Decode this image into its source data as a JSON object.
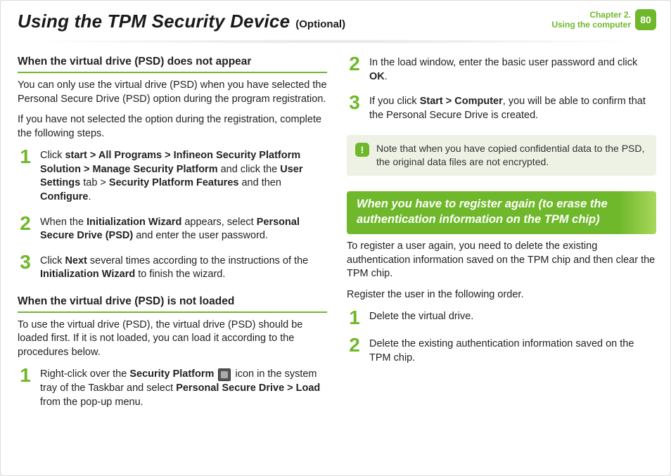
{
  "header": {
    "title": "Using the TPM Security Device",
    "subtitle": "(Optional)",
    "chapter_line1": "Chapter 2.",
    "chapter_line2": "Using the computer",
    "page_number": "80"
  },
  "left": {
    "sec1": {
      "heading": "When the virtual drive (PSD) does not appear",
      "p1": "You can only use the virtual drive (PSD) when you have selected the Personal Secure Drive (PSD) option during the program registration.",
      "p2": " If you have not selected the option during the registration, complete the following steps.",
      "steps": [
        {
          "n": "1",
          "parts": [
            {
              "t": "Click "
            },
            {
              "t": "start > All Programs > Infineon Security Platform Solution > Manage Security Platform",
              "b": true
            },
            {
              "t": " and click the "
            },
            {
              "t": "User Settings",
              "b": true
            },
            {
              "t": " tab > "
            },
            {
              "t": "Security Platform Features",
              "b": true
            },
            {
              "t": " and then "
            },
            {
              "t": "Configure",
              "b": true
            },
            {
              "t": "."
            }
          ]
        },
        {
          "n": "2",
          "parts": [
            {
              "t": "When the "
            },
            {
              "t": "Initialization Wizard",
              "b": true
            },
            {
              "t": " appears, select "
            },
            {
              "t": "Personal Secure Drive (PSD)",
              "b": true
            },
            {
              "t": " and enter the user password."
            }
          ]
        },
        {
          "n": "3",
          "parts": [
            {
              "t": "Click "
            },
            {
              "t": "Next",
              "b": true
            },
            {
              "t": " several times according to the instructions of the "
            },
            {
              "t": "Initialization Wizard",
              "b": true
            },
            {
              "t": " to finish the wizard."
            }
          ]
        }
      ]
    },
    "sec2": {
      "heading": "When the virtual drive (PSD) is not loaded",
      "p1": "To use the virtual drive (PSD), the virtual drive (PSD) should be loaded first. If it is not loaded, you can load it according to the procedures below.",
      "steps": [
        {
          "n": "1",
          "parts": [
            {
              "t": "Right-click over the "
            },
            {
              "t": "Security Platform",
              "b": true
            },
            {
              "t": " "
            },
            {
              "icon": "tray-icon"
            },
            {
              "t": " icon in the system tray of the Taskbar and select "
            },
            {
              "t": "Personal Secure Drive > Load",
              "b": true
            },
            {
              "t": " from the pop-up menu."
            }
          ]
        }
      ]
    }
  },
  "right": {
    "cont_steps": [
      {
        "n": "2",
        "parts": [
          {
            "t": "In the load window, enter the basic user password and click "
          },
          {
            "t": "OK",
            "b": true
          },
          {
            "t": "."
          }
        ]
      },
      {
        "n": "3",
        "parts": [
          {
            "t": "If you click "
          },
          {
            "t": "Start > Computer",
            "b": true
          },
          {
            "t": ", you will be able to confirm that the Personal Secure Drive is created."
          }
        ]
      }
    ],
    "note": {
      "icon": "!",
      "text": "Note that when you have copied confidential data to the PSD, the original data files are not encrypted."
    },
    "sec3": {
      "banner": "When you have to register again (to erase the authentication information on the TPM chip)",
      "p1": "To register a user again, you need to delete the existing authentication information saved on the TPM chip and then clear the TPM chip.",
      "p2": "Register the user in the following order.",
      "steps": [
        {
          "n": "1",
          "parts": [
            {
              "t": "Delete the virtual drive."
            }
          ]
        },
        {
          "n": "2",
          "parts": [
            {
              "t": "Delete the existing authentication information saved on the TPM chip."
            }
          ]
        }
      ]
    }
  }
}
